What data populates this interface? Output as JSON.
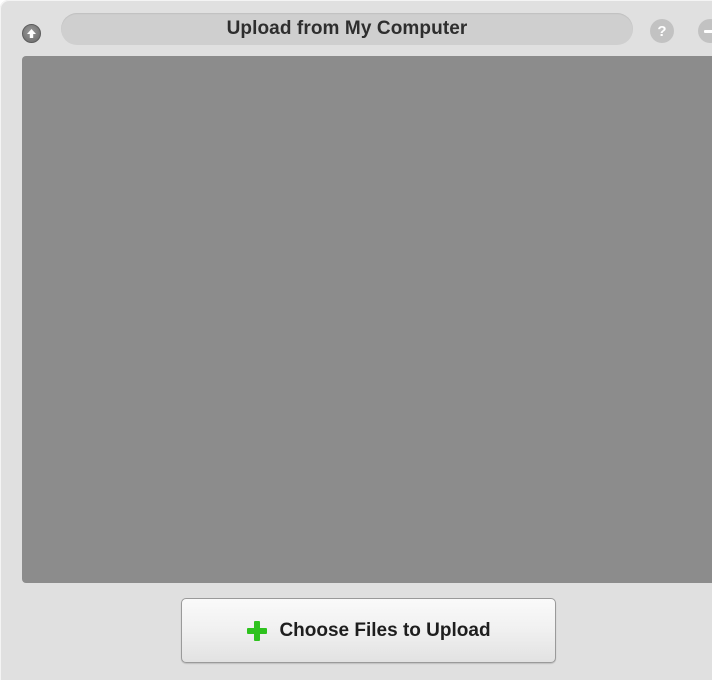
{
  "window": {
    "title": "Upload from My Computer",
    "help_label": "?"
  },
  "upload": {
    "choose_button_label": "Choose Files to Upload"
  },
  "icons": {
    "back": "circle-arrow-up-icon",
    "help": "question-icon",
    "minimize": "minimize-icon",
    "add": "plus-icon"
  },
  "colors": {
    "drop_area": "#8c8c8c",
    "plus_icon": "#2ec21e",
    "window_bg": "#e0e0e0"
  }
}
